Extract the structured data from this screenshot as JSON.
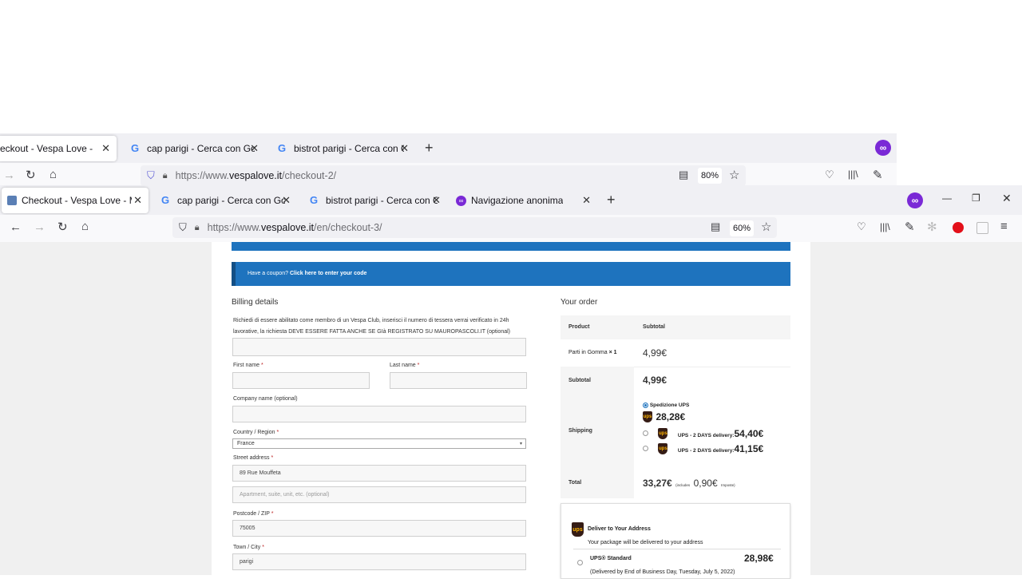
{
  "bg_window": {
    "tabs": [
      {
        "title": "eckout - Vespa Love - Mauro",
        "active": true
      },
      {
        "title": "cap parigi - Cerca con Google"
      },
      {
        "title": "bistrot parigi - Cerca con Google"
      }
    ],
    "url_prefix": "https://www.",
    "url_domain": "vespalove.it",
    "url_path": "/checkout-2/",
    "zoom": "80%",
    "new_tab": "+",
    "close": "✕"
  },
  "fg_window": {
    "tabs": [
      {
        "title": "Checkout - Vespa Love - Mauro",
        "active": true
      },
      {
        "title": "cap parigi - Cerca con Google"
      },
      {
        "title": "bistrot parigi - Cerca con Google"
      },
      {
        "title": "Navigazione anonima"
      }
    ],
    "url_prefix": "https://www.",
    "url_domain": "vespalove.it",
    "url_path": "/en/checkout-3/",
    "zoom": "60%",
    "new_tab": "+",
    "close": "✕",
    "window_controls": {
      "minimize": "—",
      "restore": "❐",
      "close": "✕"
    }
  },
  "page": {
    "coupon": {
      "prefix": "Have a coupon?",
      "link": "Click here to enter your code"
    },
    "billing": {
      "heading": "Billing details",
      "club_note_line1": "Richiedi di essere abilitato come membro di un Vespa Club, inserisci il numero di tessera verrai verificato in 24h",
      "club_note_line2": "lavorative, la richiesta DEVE ESSERE FATTA ANCHE SE GIà REGISTRATO SU MAUROPASCOLI.IT (optional)",
      "first_name_label": "First name",
      "last_name_label": "Last name",
      "company_label": "Company name (optional)",
      "country_label": "Country / Region",
      "country_value": "France",
      "street_label": "Street address",
      "street_value": "89 Rue Mouffeta",
      "apartment_placeholder": "Apartment, suite, unit, etc. (optional)",
      "postcode_label": "Postcode / ZIP",
      "postcode_value": "75005",
      "city_label": "Town / City",
      "city_value": "parigi",
      "required_mark": "*"
    },
    "order": {
      "heading": "Your order",
      "col_product": "Product",
      "col_subtotal": "Subtotal",
      "item_name": "Parti in Gomma",
      "item_qty": "× 1",
      "item_price": "4,99€",
      "subtotal_label": "Subtotal",
      "subtotal_value": "4,99€",
      "shipping_label": "Shipping",
      "ship_selected_name": "Spedizione UPS",
      "ship_selected_price": "28,28€",
      "ship_opt2_name": "UPS - 2 DAYS delivery:",
      "ship_opt2_price": "54,40€",
      "ship_opt3_name": "UPS - 2 DAYS delivery:",
      "ship_opt3_price": "41,15€",
      "total_label": "Total",
      "total_value": "33,27€",
      "total_includes": "(includes",
      "tax_value": "0,90€",
      "tax_label": "Imposte)"
    },
    "ups_box": {
      "title": "Deliver to Your Address",
      "subtitle": "Your package will be delivered to your address",
      "service": "UPS® Standard",
      "price": "28,98€",
      "note": "(Delivered by End of Business Day, Tuesday, July 5, 2022)"
    }
  },
  "colors": {
    "accent_blue": "#1e73be",
    "ups_brown": "#351c15",
    "ups_gold": "#ffb500",
    "mask_purple": "#7a29d6"
  }
}
